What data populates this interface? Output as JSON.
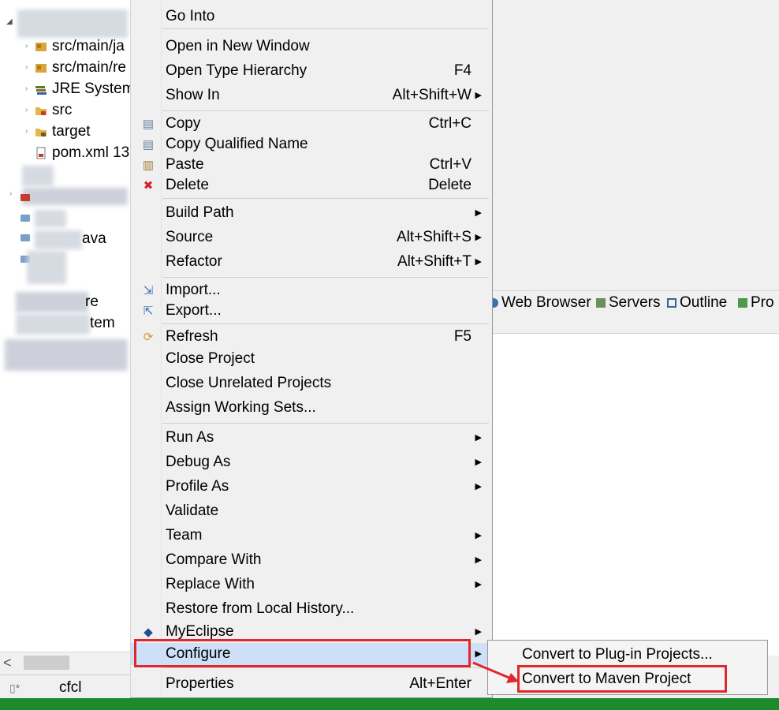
{
  "tree": {
    "items": [
      {
        "label": "src/main/ja"
      },
      {
        "label": "src/main/re"
      },
      {
        "label": "JRE System"
      },
      {
        "label": "src"
      },
      {
        "label": "target"
      },
      {
        "label": "pom.xml 13"
      }
    ],
    "fragments": [
      "ava",
      "re",
      "tem"
    ]
  },
  "scrollbar": {
    "left_arrow": "<"
  },
  "status_bar": {
    "text": "cfcl"
  },
  "view_tabs": [
    {
      "label": "Web Browser"
    },
    {
      "label": "Servers"
    },
    {
      "label": "Outline"
    },
    {
      "label": "Pro"
    }
  ],
  "context_menu": {
    "groups": [
      [
        {
          "label": "Go Into",
          "shortcut": "",
          "submenu": false
        }
      ],
      [
        {
          "label": "Open in New Window",
          "shortcut": "",
          "submenu": false
        },
        {
          "label": "Open Type Hierarchy",
          "shortcut": "F4",
          "submenu": false
        },
        {
          "label": "Show In",
          "shortcut": "Alt+Shift+W",
          "submenu": true
        }
      ],
      [
        {
          "label": "Copy",
          "shortcut": "Ctrl+C",
          "submenu": false,
          "icon": "copy-icon"
        },
        {
          "label": "Copy Qualified Name",
          "shortcut": "",
          "submenu": false,
          "icon": "copy-qualified-icon"
        },
        {
          "label": "Paste",
          "shortcut": "Ctrl+V",
          "submenu": false,
          "icon": "paste-icon"
        },
        {
          "label": "Delete",
          "shortcut": "Delete",
          "submenu": false,
          "icon": "delete-icon"
        }
      ],
      [
        {
          "label": "Build Path",
          "shortcut": "",
          "submenu": true
        },
        {
          "label": "Source",
          "shortcut": "Alt+Shift+S",
          "submenu": true
        },
        {
          "label": "Refactor",
          "shortcut": "Alt+Shift+T",
          "submenu": true
        }
      ],
      [
        {
          "label": "Import...",
          "shortcut": "",
          "submenu": false,
          "icon": "import-icon"
        },
        {
          "label": "Export...",
          "shortcut": "",
          "submenu": false,
          "icon": "export-icon"
        }
      ],
      [
        {
          "label": "Refresh",
          "shortcut": "F5",
          "submenu": false,
          "icon": "refresh-icon"
        },
        {
          "label": "Close Project",
          "shortcut": "",
          "submenu": false
        },
        {
          "label": "Close Unrelated Projects",
          "shortcut": "",
          "submenu": false
        },
        {
          "label": "Assign Working Sets...",
          "shortcut": "",
          "submenu": false
        }
      ],
      [
        {
          "label": "Run As",
          "shortcut": "",
          "submenu": true
        },
        {
          "label": "Debug As",
          "shortcut": "",
          "submenu": true
        },
        {
          "label": "Profile As",
          "shortcut": "",
          "submenu": true
        },
        {
          "label": "Validate",
          "shortcut": "",
          "submenu": false
        },
        {
          "label": "Team",
          "shortcut": "",
          "submenu": true
        },
        {
          "label": "Compare With",
          "shortcut": "",
          "submenu": true
        },
        {
          "label": "Replace With",
          "shortcut": "",
          "submenu": true
        },
        {
          "label": "Restore from Local History...",
          "shortcut": "",
          "submenu": false
        },
        {
          "label": "MyEclipse",
          "shortcut": "",
          "submenu": true,
          "icon": "myeclipse-icon"
        },
        {
          "label": "Configure",
          "shortcut": "",
          "submenu": true,
          "highlighted": true
        }
      ],
      [
        {
          "label": "Properties",
          "shortcut": "Alt+Enter",
          "submenu": false
        }
      ]
    ]
  },
  "submenu": {
    "items": [
      {
        "label": "Convert to Plug-in Projects..."
      },
      {
        "label": "Convert to Maven Project",
        "annotated": true
      }
    ]
  },
  "colors": {
    "highlight": "#cde0f7",
    "annotation_red": "#e0282c",
    "menu_bg": "#f0f0f0",
    "taskbar": "#1e8a2e"
  }
}
